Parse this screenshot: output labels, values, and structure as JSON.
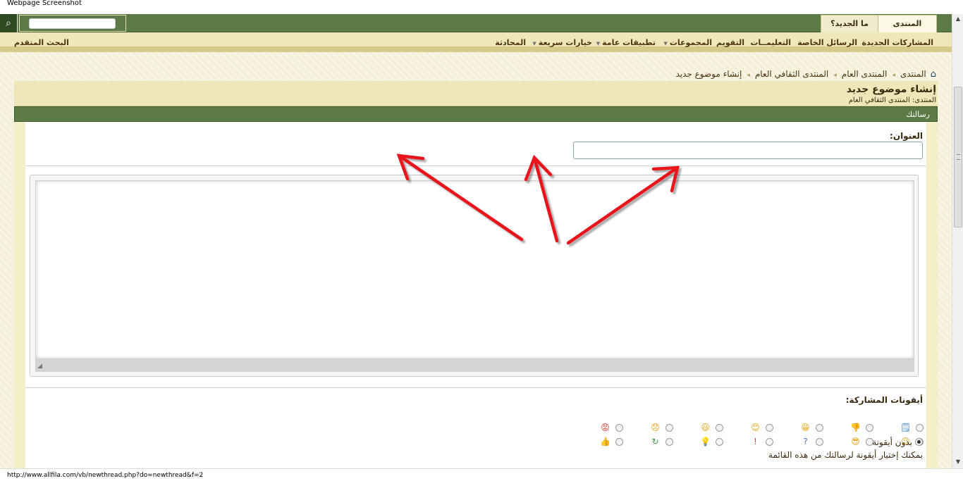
{
  "screenshot_label": "Webpage Screenshot",
  "topbar": {
    "tab_forum": "المنتدى",
    "tab_whats_new": "ما الجديد؟"
  },
  "navbar": {
    "new_posts": "المشاركات الجديدة",
    "private_messages": "الرسائل الخاصة",
    "faq": "التعليمــات",
    "calendar": "التقويم",
    "groups": "المجموعات",
    "general_apps": "تطبيقات عامة",
    "quick_options": "خيارات سريعة",
    "chat": "المحادثة",
    "advanced_search": "البحث المتقدم"
  },
  "breadcrumb": [
    "المنتدى",
    "المنتدى العام",
    "المنتدى الثقافي العام",
    "إنشاء موضوع جديد"
  ],
  "page": {
    "title": "إنشاء موضوع جديد",
    "subtitle": "المنتدى: المنتدى الثقافي العام"
  },
  "panel": {
    "header": "رسالتك",
    "title_label": "العنوان:",
    "title_value": "",
    "icons_label": "أيقونات المشاركة:",
    "no_icon_label": "بدون أيقونة",
    "hint": "بمكنك إختيار أيقونة لرسالتك من هذه القائمة"
  },
  "post_icons": [
    {
      "name": "page-icon",
      "glyph": "🗒",
      "color": "#3f7fc6"
    },
    {
      "name": "thumbs-down-icon",
      "glyph": "👎",
      "color": "#d4573c"
    },
    {
      "name": "grin-icon",
      "glyph": "😁",
      "color": "#e3a51b"
    },
    {
      "name": "smile-icon",
      "glyph": "😊",
      "color": "#e3a51b"
    },
    {
      "name": "happy-icon",
      "glyph": "😃",
      "color": "#e3a51b"
    },
    {
      "name": "sad-icon",
      "glyph": "😞",
      "color": "#e3a51b"
    },
    {
      "name": "angry-icon",
      "glyph": "😡",
      "color": "#d93a2b"
    },
    {
      "name": "wink-icon",
      "glyph": "😉",
      "color": "#e3a51b"
    },
    {
      "name": "cool-icon",
      "glyph": "😎",
      "color": "#e3a51b"
    },
    {
      "name": "question-icon",
      "glyph": "?",
      "color": "#3f7fc6"
    },
    {
      "name": "exclamation-icon",
      "glyph": "!",
      "color": "#d93a2b"
    },
    {
      "name": "lightbulb-icon",
      "glyph": "💡",
      "color": "#e3a51b"
    },
    {
      "name": "arrow-icon",
      "glyph": "↻",
      "color": "#3b9a3b"
    },
    {
      "name": "thumbs-up-icon",
      "glyph": "👍",
      "color": "#3b9a3b"
    }
  ],
  "status_url": "http://www.allfila.com/vb/newthread.php?do=newthread&f=2"
}
